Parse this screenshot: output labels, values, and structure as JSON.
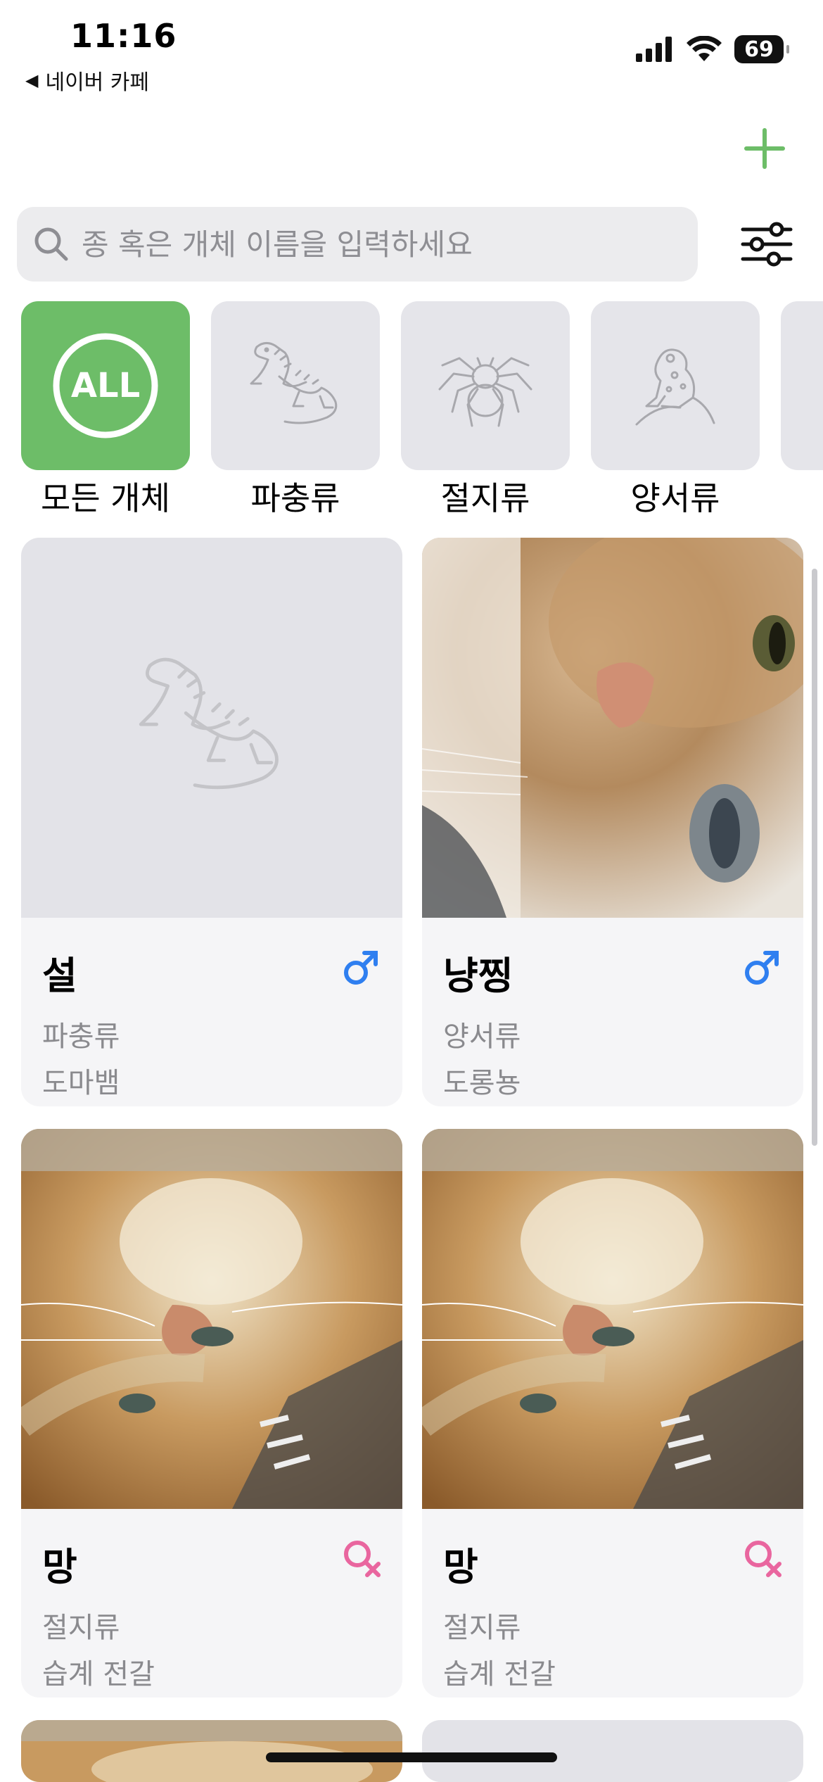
{
  "status": {
    "time": "11:16",
    "back_label": "네이버 카페",
    "battery": "69"
  },
  "search": {
    "placeholder": "종 혹은 개체 이름을 입력하세요"
  },
  "categories": [
    {
      "label": "모든 개체",
      "icon": "all-badge-icon",
      "badge": "ALL",
      "active": true
    },
    {
      "label": "파충류",
      "icon": "iguana-icon",
      "active": false
    },
    {
      "label": "절지류",
      "icon": "tarantula-icon",
      "active": false
    },
    {
      "label": "양서류",
      "icon": "frog-icon",
      "active": false
    }
  ],
  "cards": [
    {
      "name": "설",
      "gender": "male",
      "type": "파충류",
      "species": "도마뱀",
      "image": "placeholder-iguana"
    },
    {
      "name": "냥찡",
      "gender": "male",
      "type": "양서류",
      "species": "도롱뇽",
      "image": "cat-photo"
    },
    {
      "name": "망",
      "gender": "female",
      "type": "절지류",
      "species": "습계 전갈",
      "image": "cat-photo"
    },
    {
      "name": "망",
      "gender": "female",
      "type": "절지류",
      "species": "습계 전갈",
      "image": "cat-photo"
    }
  ],
  "colors": {
    "accent": "#6dbd68",
    "male": "#2f7ff0",
    "female": "#e9669f",
    "secondary_text": "#8a8a8e"
  }
}
